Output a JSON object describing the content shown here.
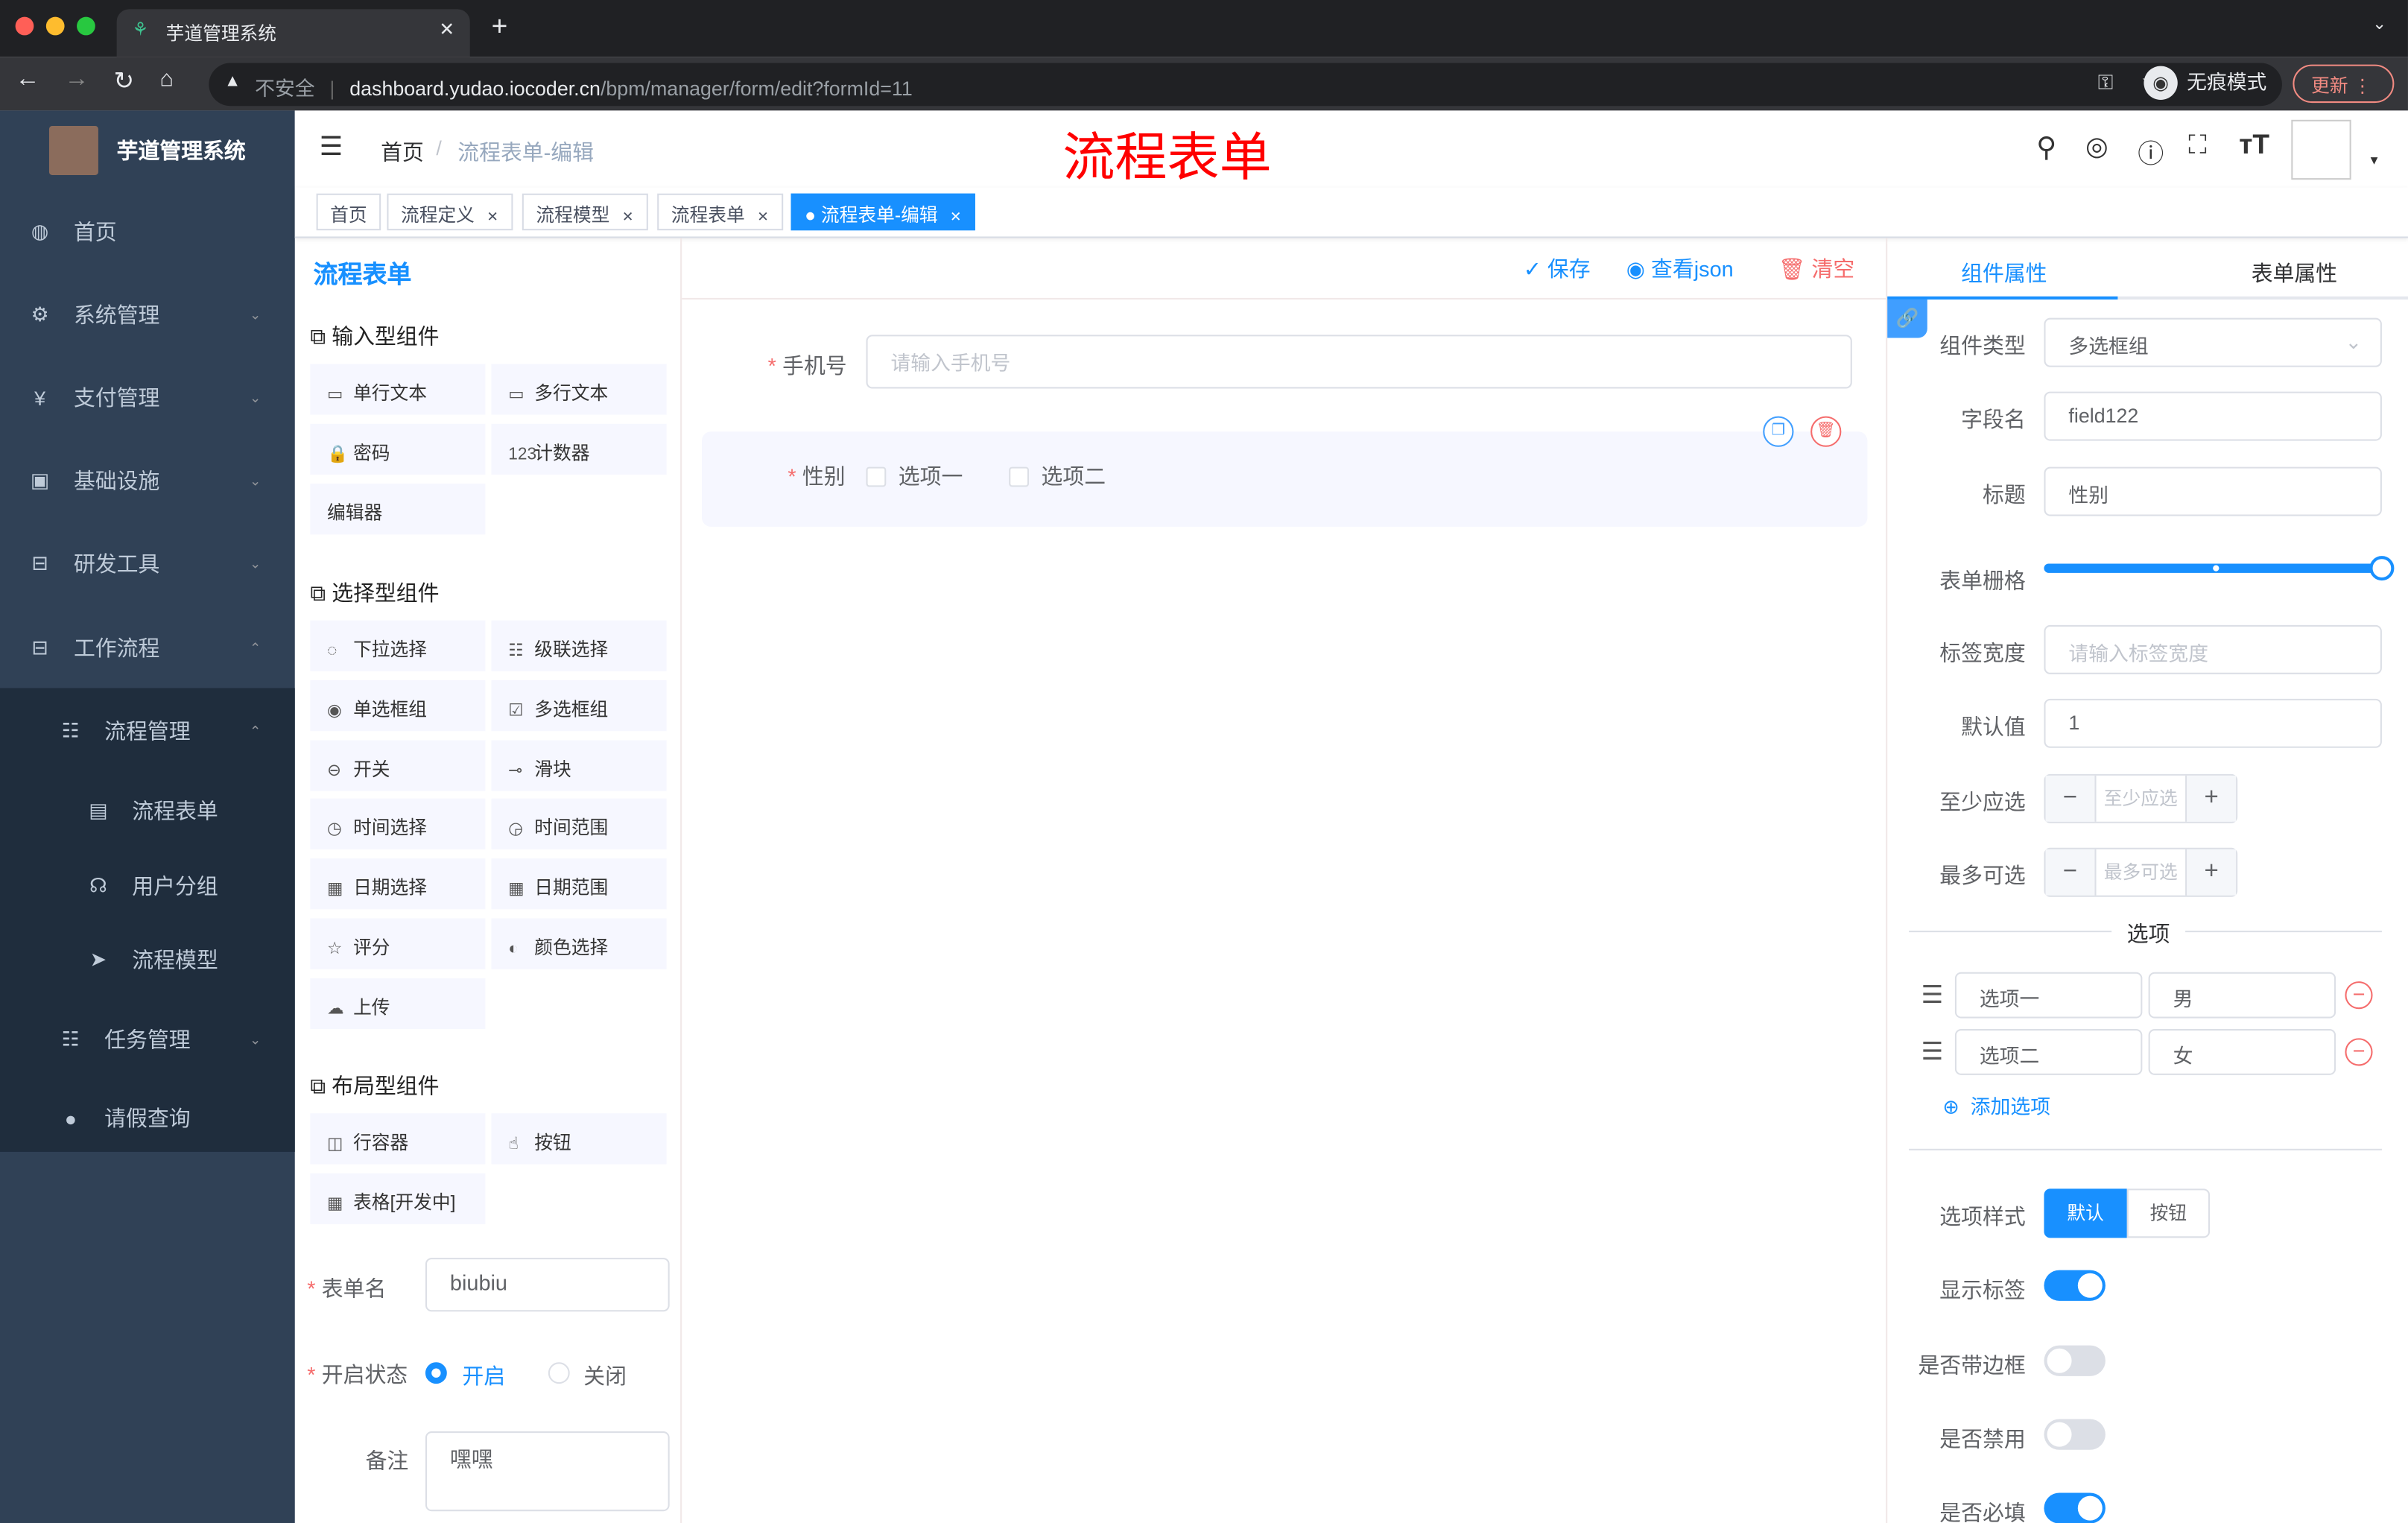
{
  "browser": {
    "tab_title": "芋道管理系统",
    "url_warning": "不安全",
    "url_host": "dashboard.yudao.iocoder.cn",
    "url_path": "/bpm/manager/form/edit?formId=11",
    "incognito": "无痕模式",
    "update": "更新"
  },
  "sidebar": {
    "logo_title": "芋道管理系统",
    "items": [
      {
        "label": "首页",
        "icon": "dashboard-icon"
      },
      {
        "label": "系统管理",
        "icon": "gear-icon"
      },
      {
        "label": "支付管理",
        "icon": "yen-icon"
      },
      {
        "label": "基础设施",
        "icon": "monitor-icon"
      },
      {
        "label": "研发工具",
        "icon": "toolbox-icon"
      },
      {
        "label": "工作流程",
        "icon": "toolbox-icon"
      },
      {
        "label": "流程管理",
        "icon": "tree-icon"
      },
      {
        "label": "流程表单",
        "icon": "form-icon"
      },
      {
        "label": "用户分组",
        "icon": "peoples-icon"
      },
      {
        "label": "流程模型",
        "icon": "send-icon"
      },
      {
        "label": "任务管理",
        "icon": "tree-icon"
      },
      {
        "label": "请假查询",
        "icon": "user-icon"
      }
    ]
  },
  "navbar": {
    "breadcrumb": [
      "首页",
      "流程表单-编辑"
    ],
    "overlay_title": "流程表单"
  },
  "tags": [
    "首页",
    "流程定义",
    "流程模型",
    "流程表单",
    "流程表单-编辑"
  ],
  "editor": {
    "title": "流程表单",
    "save": "保存",
    "view_json": "查看json",
    "clear": "清空"
  },
  "palette": {
    "sections": [
      {
        "title": "输入型组件",
        "items": [
          "单行文本",
          "多行文本",
          "密码",
          "计数器",
          "编辑器"
        ]
      },
      {
        "title": "选择型组件",
        "items": [
          "下拉选择",
          "级联选择",
          "单选框组",
          "多选框组",
          "开关",
          "滑块",
          "时间选择",
          "时间范围",
          "日期选择",
          "日期范围",
          "评分",
          "颜色选择",
          "上传"
        ]
      },
      {
        "title": "布局型组件",
        "items": [
          "行容器",
          "按钮",
          "表格[开发中]"
        ]
      }
    ]
  },
  "form_meta": {
    "name_label": "表单名",
    "name_value": "biubiu",
    "status_label": "开启状态",
    "status_on": "开启",
    "status_off": "关闭",
    "status_selected": "开启",
    "remark_label": "备注",
    "remark_value": "嘿嘿"
  },
  "canvas": {
    "phone_label": "手机号",
    "phone_placeholder": "请输入手机号",
    "gender_label": "性别",
    "options": [
      "选项一",
      "选项二"
    ]
  },
  "props": {
    "tab_component": "组件属性",
    "tab_form": "表单属性",
    "type_label": "组件类型",
    "type_value": "多选框组",
    "field_label": "字段名",
    "field_value": "field122",
    "title_label": "标题",
    "title_value": "性别",
    "grid_label": "表单栅格",
    "grid_value": 24,
    "grid_max": 24,
    "labelwidth_label": "标签宽度",
    "labelwidth_placeholder": "请输入标签宽度",
    "default_label": "默认值",
    "default_value": "1",
    "min_label": "至少应选",
    "min_placeholder": "至少应选",
    "max_label": "最多可选",
    "max_placeholder": "最多可选",
    "options_title": "选项",
    "options": [
      {
        "label": "选项一",
        "value": "男"
      },
      {
        "label": "选项二",
        "value": "女"
      }
    ],
    "add_option": "添加选项",
    "style_label": "选项样式",
    "style_default": "默认",
    "style_button": "按钮",
    "show_label": "显示标签",
    "show_label_on": true,
    "border_label": "是否带边框",
    "border_on": false,
    "disabled_label": "是否禁用",
    "disabled_on": false,
    "required_label": "是否必填",
    "required_on": true
  },
  "colors": {
    "primary": "#1890ff",
    "sidebar": "#304156",
    "danger": "#f56c6c",
    "title_red": "#ff0000"
  }
}
